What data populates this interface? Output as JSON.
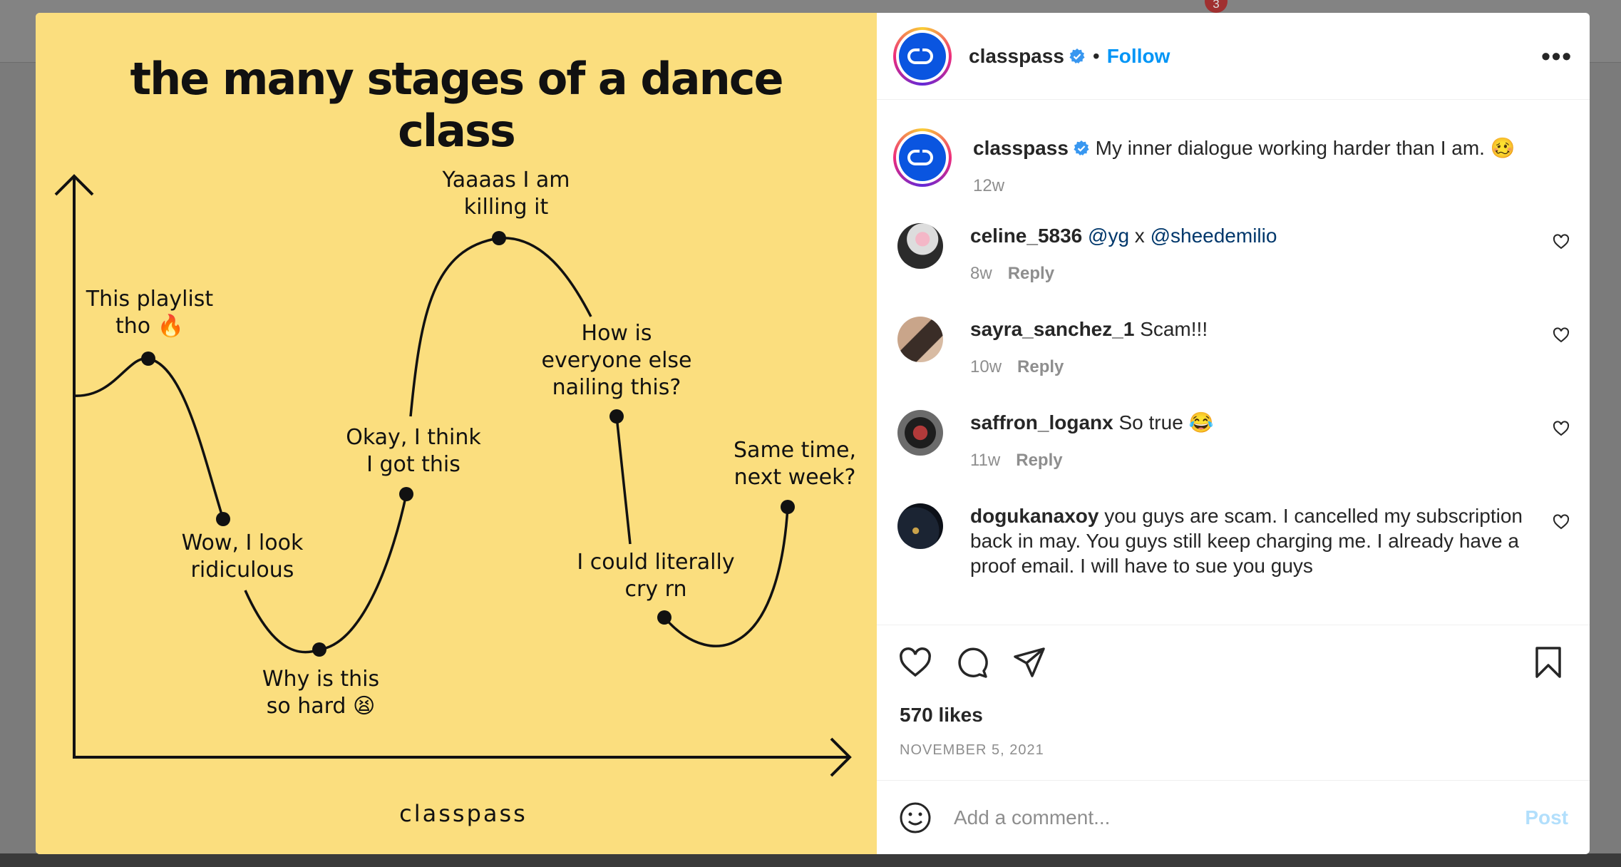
{
  "background": {
    "notification_count": "3"
  },
  "post": {
    "image": {
      "title": "the many stages of a dance class",
      "brand": "classpass",
      "stages": [
        {
          "label": "This playlist\ntho 🔥"
        },
        {
          "label": "Wow, I look\nridiculous"
        },
        {
          "label": "Why is this\nso hard 😫"
        },
        {
          "label": "Okay, I think\nI got this"
        },
        {
          "label": "Yaaaas I am\nkilling it"
        },
        {
          "label": "How is\neveryone else\nnailing this?"
        },
        {
          "label": "I could literally\ncry rn"
        },
        {
          "label": "Same time,\nnext week?"
        }
      ],
      "colors": {
        "background": "#fbde7e",
        "line": "#111111"
      }
    },
    "header": {
      "username": "classpass",
      "separator": "•",
      "follow_label": "Follow",
      "more_label": "•••"
    },
    "caption": {
      "username": "classpass",
      "text": "My inner dialogue working harder than I am. 🥴",
      "time": "12w"
    },
    "comments": [
      {
        "username": "celine_5836",
        "text_parts": [
          "@yg",
          " x ",
          "@sheedemilio"
        ],
        "time": "8w",
        "reply_label": "Reply"
      },
      {
        "username": "sayra_sanchez_1",
        "text": "Scam!!!",
        "time": "10w",
        "reply_label": "Reply"
      },
      {
        "username": "saffron_loganx",
        "text": "So true 😂",
        "time": "11w",
        "reply_label": "Reply"
      },
      {
        "username": "dogukanaxoy",
        "text": "you guys are scam. I cancelled my subscription back in may. You guys still keep charging me. I already have a proof email. I will have to sue you guys"
      }
    ],
    "likes": "570 likes",
    "date": "NOVEMBER 5, 2021",
    "add_comment": {
      "placeholder": "Add a comment...",
      "post_label": "Post"
    },
    "colors": {
      "link": "#0095f6",
      "verified": "#3897f0",
      "mention": "#00376b"
    }
  }
}
